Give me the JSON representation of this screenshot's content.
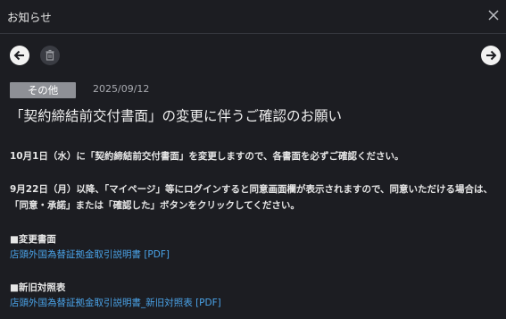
{
  "header": {
    "title": "お知らせ"
  },
  "toolbar": {
    "prev_icon": "arrow-left-icon",
    "delete_icon": "trash-icon",
    "next_icon": "arrow-right-icon",
    "close_icon": "close-icon"
  },
  "notice": {
    "category": "その他",
    "date": "2025/09/12",
    "title": "「契約締結前交付書面」の変更に伴うご確認のお願い",
    "paragraph1": "10月1日（水）に「契約締結前交付書面」を変更しますので、各書面を必ずご確認ください。",
    "paragraph2": "9月22日（月）以降、「マイページ」等にログインすると同意画面欄が表示されますので、同意いただける場合は、「同意・承諾」または「確認した」ボタンをクリックしてください。",
    "sections": [
      {
        "heading": "■変更書面",
        "link": "店頭外国為替証拠金取引説明書 [PDF]"
      },
      {
        "heading": "■新旧対照表",
        "link": "店頭外国為替証拠金取引説明書_新旧対照表 [PDF]"
      }
    ]
  },
  "colors": {
    "background": "#1c1d22",
    "badge": "#8e9096",
    "link": "#4aa3e8",
    "text": "#e6e6e6"
  }
}
